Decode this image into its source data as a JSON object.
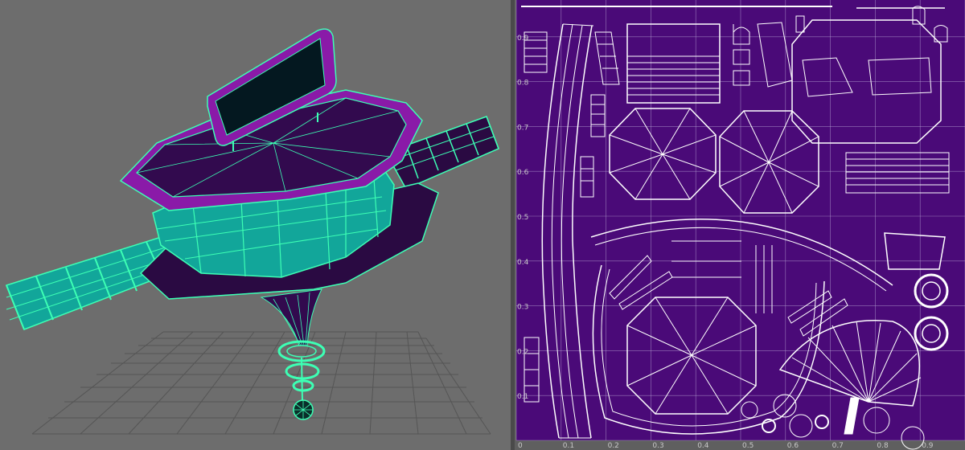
{
  "colors": {
    "viewport_bg": "#6d6d6d",
    "wire": "#3dffb4",
    "purple_face": "#8a1aa8",
    "dark_face": "#320a4e",
    "teal_face": "#12a69a",
    "screen": "#041820",
    "uv_bg": "#4a0a78",
    "uv_grid": "#b9a7d6",
    "uv_lines": "#ffffff"
  },
  "viewport": {
    "name": "3d-perspective-viewport"
  },
  "uv_editor": {
    "name": "uv-texture-editor",
    "u_axis_ticks": [
      "0",
      "0.1",
      "0.2",
      "0.3",
      "0.4",
      "0.5",
      "0.6",
      "0.7",
      "0.8",
      "0.9"
    ],
    "v_axis_ticks": [
      "0.9",
      "0.8",
      "0.7",
      "0.6",
      "0.5",
      "0.4",
      "0.3",
      "0.2",
      "0.1"
    ]
  }
}
